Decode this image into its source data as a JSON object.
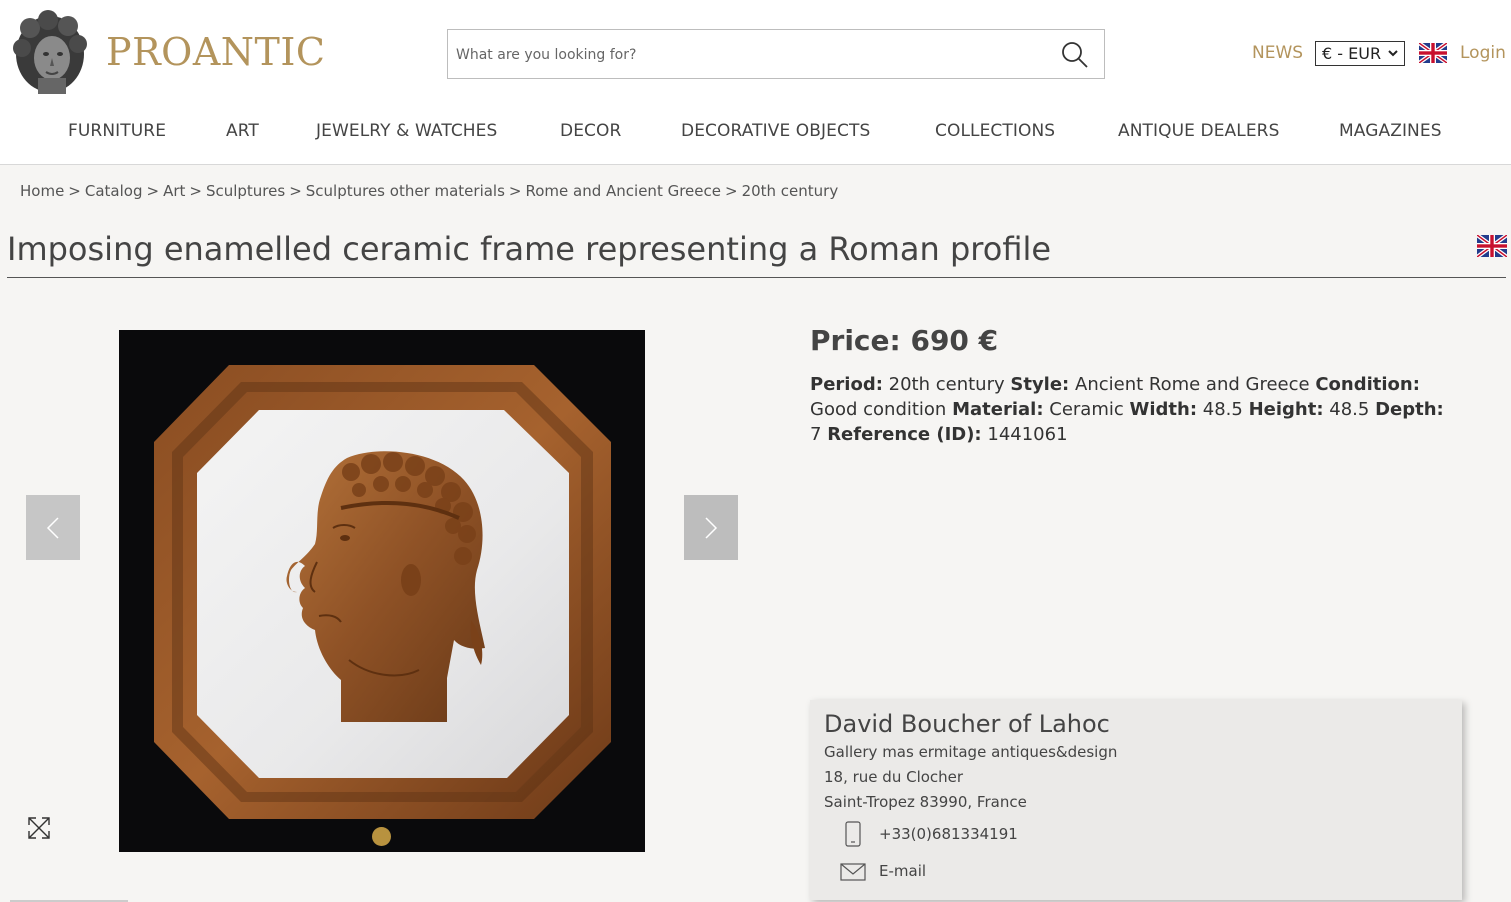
{
  "brand": {
    "name": "PROANTIC"
  },
  "search": {
    "placeholder": "What are you looking for?"
  },
  "header": {
    "news_label": "NEWS",
    "currency": "€ - EUR",
    "login_label": "Login"
  },
  "nav": {
    "items": [
      {
        "label": "FURNITURE"
      },
      {
        "label": "ART"
      },
      {
        "label": "JEWELRY & WATCHES"
      },
      {
        "label": "DECOR"
      },
      {
        "label": "DECORATIVE OBJECTS"
      },
      {
        "label": "COLLECTIONS"
      },
      {
        "label": "ANTIQUE DEALERS"
      },
      {
        "label": "MAGAZINES"
      }
    ]
  },
  "breadcrumb": {
    "items": [
      {
        "label": "Home"
      },
      {
        "label": "Catalog"
      },
      {
        "label": "Art"
      },
      {
        "label": "Sculptures"
      },
      {
        "label": "Sculptures other materials"
      },
      {
        "label": "Rome and Ancient Greece"
      },
      {
        "label": "20th century"
      }
    ],
    "separator": ">"
  },
  "product": {
    "title": "Imposing enamelled ceramic frame representing a Roman profile",
    "price": "Price: 690 €",
    "specs": [
      {
        "label": "Period:",
        "value": "20th century"
      },
      {
        "label": "Style:",
        "value": "Ancient Rome and Greece"
      },
      {
        "label": "Condition:",
        "value": "Good condition"
      },
      {
        "label": "Material:",
        "value": "Ceramic"
      },
      {
        "label": "Width:",
        "value": "48.5"
      },
      {
        "label": "Height:",
        "value": "48.5"
      },
      {
        "label": "Depth:",
        "value": "7"
      },
      {
        "label": "Reference (ID):",
        "value": "1441061"
      }
    ]
  },
  "dealer": {
    "name": "David Boucher of Lahoc",
    "gallery": "Gallery mas ermitage antiques&design",
    "address_line1": "18, rue du Clocher",
    "address_line2": "Saint-Tropez 83990, France",
    "phone": "+33(0)681334191",
    "email_label": "E-mail"
  },
  "colors": {
    "gold": "#b3945c",
    "background": "#f6f5f3",
    "dot": "#b8923f"
  },
  "icons": {
    "search": "search-icon",
    "flag": "uk-flag-icon",
    "prev": "chevron-left-icon",
    "next": "chevron-right-icon",
    "expand": "expand-icon",
    "phone": "phone-icon",
    "mail": "mail-icon"
  }
}
